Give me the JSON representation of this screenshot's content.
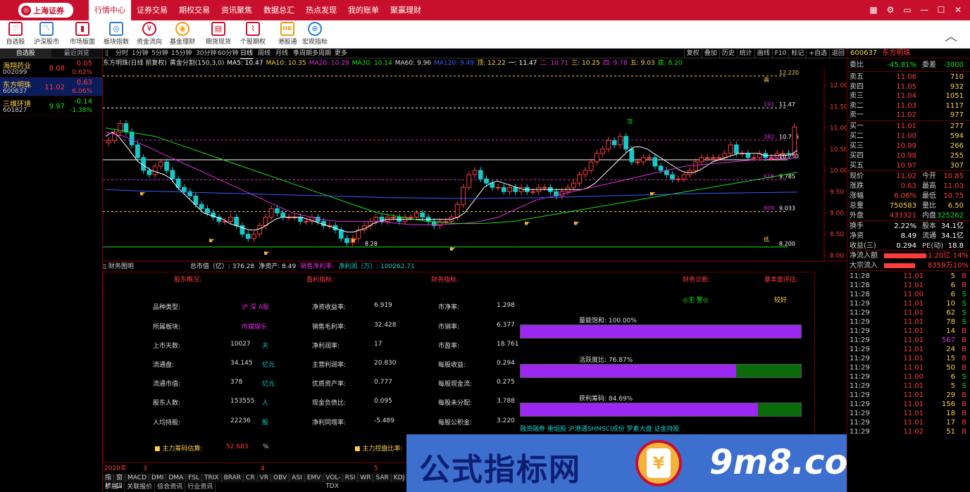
{
  "app": {
    "logo_text": "上海证券",
    "menu": [
      "行情中心",
      "证券交易",
      "期权交易",
      "资讯聚焦",
      "数据总汇",
      "热点发现",
      "我的账单",
      "聚赢理财"
    ],
    "window_controls": [
      "▦",
      "⚙",
      "▭",
      "—",
      "☐",
      "✕"
    ]
  },
  "toolbar": {
    "items": [
      "自选股",
      "沪深股市",
      "市场版面",
      "板块指数",
      "资金流向",
      "基金理财",
      "期货现货",
      "个股期权",
      "港股通",
      "宏观指标"
    ],
    "icons": [
      "heart",
      "line",
      "bar",
      "target",
      "yen",
      "coin",
      "doc",
      "chart",
      "hk",
      "globe"
    ]
  },
  "watchlist": {
    "tabs": [
      "自选股",
      "最近浏览"
    ],
    "items": [
      {
        "name": "海翔药业",
        "code": "002099",
        "price": "8.08",
        "change": "0.05",
        "pct": "0.62%",
        "dir": "up"
      },
      {
        "name": "东方明珠",
        "code": "600637",
        "price": "11.02",
        "change": "0.63",
        "pct": "6.06%",
        "dir": "up",
        "selected": true
      },
      {
        "name": "三维环境",
        "code": "601827",
        "price": "9.97",
        "change": "-0.14",
        "pct": "-1.38%",
        "dir": "dn"
      }
    ]
  },
  "kline": {
    "periods": [
      "分时",
      "1分钟",
      "5分钟",
      "15分钟",
      "30分钟",
      "60分钟",
      "日线",
      "周线",
      "月线",
      "季周期",
      "多周期",
      "更多"
    ],
    "selected_period": "日线",
    "right_tabs": [
      "复权",
      "叠加",
      "历史",
      "统计",
      "画线",
      "F10",
      "标记",
      "+自选",
      "返回"
    ],
    "legend": [
      {
        "t": "东方明珠(日线 前复权)",
        "c": "#dddddd"
      },
      {
        "t": "黄金分割(150,3,0)",
        "c": "#dddddd"
      },
      {
        "t": "MA5: 10.47",
        "c": "#ffffff"
      },
      {
        "t": "MA10: 10.35",
        "c": "#ffd24a"
      },
      {
        "t": "MA20: 10.29",
        "c": "#e12be0"
      },
      {
        "t": "MA30: 10.14",
        "c": "#17e217"
      },
      {
        "t": "MA60: 9.96",
        "c": "#dddddd"
      },
      {
        "t": "MA120: 9.49",
        "c": "#3a5cff"
      },
      {
        "t": "顶: 12.22",
        "c": "#ffd24a"
      },
      {
        "t": "一: 11.47",
        "c": "#ffffff"
      },
      {
        "t": "二: 10.71",
        "c": "#e12be0"
      },
      {
        "t": "三: 10.25",
        "c": "#ffd24a"
      },
      {
        "t": "四: 9.78",
        "c": "#e12be0"
      },
      {
        "t": "五: 9.03",
        "c": "#ffd24a"
      },
      {
        "t": "底: 8.20",
        "c": "#17e217"
      }
    ],
    "y_ticks": [
      "12.00",
      "11.50",
      "11.00",
      "10.50",
      "10.00",
      "9.50",
      "9.00",
      "8.50",
      "8.00"
    ],
    "level_labels": {
      "top": "12.220",
      "high_tag": "高",
      "l191": "191",
      "l382": "382",
      "l618": "618",
      "l809": "809",
      "l1147": "11.47",
      "l1071": "10.716",
      "l1025": "10.250",
      "l978": "9.785",
      "l903": "9.033",
      "l820": "8.200",
      "low_tag": "低",
      "low_price": "8.28",
      "ding": "顶"
    },
    "chart_data": {
      "type": "candlestick",
      "ylim": [
        7.85,
        12.4
      ],
      "close": [
        10.7,
        10.9,
        11.1,
        10.9,
        10.6,
        10.3,
        10.0,
        9.9,
        10.1,
        10.2,
        10.0,
        9.8,
        9.6,
        9.5,
        9.4,
        9.2,
        9.1,
        9.0,
        8.9,
        8.8,
        8.8,
        8.9,
        8.7,
        8.5,
        8.4,
        8.5,
        8.7,
        8.9,
        9.1,
        9.0,
        8.9,
        8.9,
        8.9,
        8.8,
        8.8,
        8.9,
        8.8,
        8.7,
        8.7,
        8.6,
        8.4,
        8.3,
        8.4,
        8.6,
        8.7,
        8.8,
        8.9,
        8.8,
        8.9,
        8.9,
        8.8,
        8.9,
        8.9,
        9.0,
        8.9,
        8.8,
        8.7,
        8.8,
        8.8,
        8.9,
        9.2,
        9.6,
        9.9,
        10.0,
        9.8,
        9.7,
        9.6,
        9.6,
        9.5,
        9.6,
        9.5,
        9.6,
        9.5,
        9.5,
        9.6,
        9.6,
        9.5,
        9.4,
        9.5,
        9.6,
        9.7,
        9.9,
        10.0,
        10.2,
        10.4,
        10.5,
        10.7,
        10.6,
        10.8,
        10.5,
        10.2,
        10.2,
        10.3,
        10.3,
        10.1,
        10.0,
        9.9,
        9.8,
        9.8,
        9.9,
        10.0,
        10.2,
        10.3,
        10.3,
        10.3,
        10.3,
        10.4,
        10.6,
        10.4,
        10.4,
        10.3,
        10.3,
        10.4,
        10.3,
        10.3,
        10.4,
        10.4,
        10.39,
        11.02
      ],
      "ma5": [
        10.8,
        10.9,
        10.8,
        10.6,
        10.4,
        10.2,
        10.1,
        10.0,
        9.95,
        9.9,
        9.8,
        9.6,
        9.45,
        9.3,
        9.15,
        9.0,
        8.95,
        8.9,
        8.85,
        8.75,
        8.7,
        8.65,
        8.6,
        8.6,
        8.65,
        8.75,
        8.85,
        8.9,
        8.9,
        8.9,
        8.9,
        8.85,
        8.8,
        8.75,
        8.7,
        8.65,
        8.6,
        8.55,
        8.55,
        8.6,
        8.65,
        8.75,
        8.8,
        8.85,
        8.85,
        8.85,
        8.85,
        8.85,
        8.85,
        8.85,
        8.85,
        8.85,
        8.85,
        8.85,
        8.9,
        9.0,
        9.2,
        9.4,
        9.6,
        9.7,
        9.75,
        9.7,
        9.65,
        9.6,
        9.55,
        9.55,
        9.55,
        9.55,
        9.55,
        9.55,
        9.55,
        9.55,
        9.55,
        9.55,
        9.6,
        9.7,
        9.85,
        10.0,
        10.15,
        10.3,
        10.45,
        10.55,
        10.55,
        10.5,
        10.4,
        10.3,
        10.2,
        10.1,
        10.0,
        9.95,
        9.95,
        10.0,
        10.1,
        10.2,
        10.25,
        10.3,
        10.35,
        10.4,
        10.4,
        10.4,
        10.4,
        10.35,
        10.35,
        10.35,
        10.35,
        10.37,
        10.47
      ],
      "ma20": [
        10.9,
        10.85,
        10.8,
        10.7,
        10.6,
        10.5,
        10.4,
        10.3,
        10.2,
        10.1,
        10.0,
        9.9,
        9.8,
        9.7,
        9.6,
        9.5,
        9.4,
        9.3,
        9.2,
        9.1,
        9.0,
        8.95,
        8.9,
        8.85,
        8.82,
        8.8,
        8.8,
        8.8,
        8.8,
        8.8,
        8.78,
        8.76,
        8.74,
        8.72,
        8.72,
        8.72,
        8.73,
        8.74,
        8.75,
        8.77,
        8.8,
        8.85,
        8.9,
        9.0,
        9.1,
        9.2,
        9.3,
        9.35,
        9.4,
        9.45,
        9.5,
        9.55,
        9.6,
        9.65,
        9.7,
        9.75,
        9.8,
        9.85,
        9.9,
        9.95,
        10.0,
        10.05,
        10.1,
        10.12,
        10.14,
        10.16,
        10.18,
        10.2,
        10.22,
        10.24,
        10.25,
        10.26,
        10.27,
        10.28,
        10.29
      ],
      "ma60": [
        11.0,
        10.95,
        10.9,
        10.85,
        10.8,
        10.7,
        10.6,
        10.5,
        10.4,
        10.3,
        10.2,
        10.1,
        10.0,
        9.9,
        9.8,
        9.7,
        9.6,
        9.5,
        9.4,
        9.3,
        9.2,
        9.1,
        9.0,
        8.95,
        8.9,
        8.85,
        8.8,
        8.78,
        8.76,
        8.75,
        8.75,
        8.76,
        8.78,
        8.8,
        8.85,
        8.9,
        8.95,
        9.0,
        9.05,
        9.1,
        9.15,
        9.2,
        9.25,
        9.3,
        9.35,
        9.4,
        9.45,
        9.5,
        9.55,
        9.6,
        9.65,
        9.7,
        9.75,
        9.8,
        9.85,
        9.9,
        9.96
      ],
      "ma120": [
        9.55,
        9.52,
        9.5,
        9.48,
        9.46,
        9.44,
        9.42,
        9.4,
        9.38,
        9.36,
        9.35,
        9.34,
        9.34,
        9.35,
        9.36,
        9.38,
        9.4,
        9.42,
        9.44,
        9.46,
        9.47,
        9.48,
        9.49
      ],
      "levels": [
        12.22,
        11.47,
        10.71,
        10.25,
        9.78,
        9.03,
        8.2
      ]
    }
  },
  "finance": {
    "title": "财务图明",
    "summary": [
      {
        "t": "总市值（亿）: 376.28",
        "c": "#dddddd"
      },
      {
        "t": "净资产: 8.49",
        "c": "#dddddd"
      },
      {
        "t": "销售净利率:",
        "c": "#e12be0"
      },
      {
        "t": "净利润（万）: 100262.71",
        "c": "#17c8c8"
      }
    ],
    "headers": [
      "股东概况:",
      "盈利指标:",
      "财务指标:",
      "财务诊断:",
      "基本面评估:"
    ],
    "col1": [
      [
        "品种类型:",
        "沪 深 A股",
        ""
      ],
      [
        "所属板块:",
        "传媒娱乐",
        ""
      ],
      [
        "上市天数:",
        "10027",
        "天"
      ],
      [
        "流通盘:",
        "34.145",
        "亿元"
      ],
      [
        "流通市值:",
        "378",
        "亿元"
      ],
      [
        "股东人数:",
        "153555",
        "人"
      ],
      [
        "人均持股:",
        "22236",
        "股"
      ]
    ],
    "col2": [
      [
        "净资收益率:",
        "6.919"
      ],
      [
        "销售毛利率:",
        "32.428"
      ],
      [
        "净利润率:",
        "17"
      ],
      [
        "主营利润率:",
        "20.830"
      ],
      [
        "优质资产率:",
        "0.777"
      ],
      [
        "现金负债比:",
        "0.095"
      ],
      [
        "净利同增率:",
        "-5.489"
      ]
    ],
    "col3": [
      [
        "市净率:",
        "1.298"
      ],
      [
        "市销率:",
        "6.377"
      ],
      [
        "市盈率:",
        "18.761"
      ],
      [
        "每股收益:",
        "0.294"
      ],
      [
        "每股现金流:",
        "0.275"
      ],
      [
        "每股未分配:",
        "3.788"
      ],
      [
        "每股公积金:",
        "3.220"
      ]
    ],
    "diag": "◎无 警◎",
    "assess": "较好",
    "bars": [
      {
        "label": "量能饱和:  100.00%",
        "fill": 1.0
      },
      {
        "label": "活跃度比:  76.87%",
        "fill": 0.7687
      },
      {
        "label": "获利筹码:  84.69%",
        "fill": 0.8469
      }
    ],
    "concepts": "融资融券 重组股 沪港通SHMSCI成份 罗素大盘 证金持股",
    "chip_label": "主力筹码估算:",
    "chip_value": "52.683",
    "chip_unit": "%",
    "ctrl_label": "主力控盘比率:"
  },
  "bottom": {
    "year_row": [
      "2020年",
      "3",
      "4",
      "5"
    ],
    "indicators": [
      "指标A",
      "窗口",
      "MACD",
      "DMI",
      "DMA",
      "FSL",
      "TRIX",
      "BRAR",
      "CR",
      "VR",
      "OBV",
      "ASI",
      "EMV",
      "VOL-TDX",
      "RSI",
      "WR",
      "SAR",
      "KDJ",
      "C"
    ],
    "tabs": [
      "扩展A",
      "关联报价",
      "综合资讯",
      "行业资讯"
    ]
  },
  "watermark": {
    "cn": "公式指标网",
    "en": "9m8.com",
    "seal_char": "¥"
  },
  "quote": {
    "code": "600637",
    "name": "东方明珠",
    "weibi_label": "委比",
    "weibi": "-45.81%",
    "weicha_label": "委差",
    "weicha": "-3000",
    "asks": [
      [
        "卖五",
        "11.06",
        "710"
      ],
      [
        "卖四",
        "11.05",
        "932"
      ],
      [
        "卖三",
        "11.04",
        "1051"
      ],
      [
        "卖二",
        "11.03",
        "1117"
      ],
      [
        "卖一",
        "11.02",
        "977"
      ]
    ],
    "bids": [
      [
        "买一",
        "11.01",
        "277"
      ],
      [
        "买二",
        "11.00",
        "594"
      ],
      [
        "买三",
        "10.99",
        "266"
      ],
      [
        "买四",
        "10.98",
        "255"
      ],
      [
        "买五",
        "10.97",
        "307"
      ]
    ],
    "stats": [
      [
        "现价",
        "11.02",
        "up",
        "今开",
        "10.85",
        "up"
      ],
      [
        "涨跌",
        "0.63",
        "up",
        "最高",
        "11.03",
        "up"
      ],
      [
        "涨幅",
        "6.06%",
        "up",
        "最低",
        "10.75",
        "up"
      ],
      [
        "总量",
        "750583",
        "yel",
        "量比",
        "6.50",
        "yel"
      ],
      [
        "外盘",
        "433321",
        "up",
        "内盘",
        "325262",
        "dn"
      ]
    ],
    "stats2": [
      [
        "换手",
        "2.22%",
        "股本",
        "34.1亿"
      ],
      [
        "净资",
        "8.49",
        "流通",
        "34.1亿"
      ],
      [
        "收益(三)",
        "0.294",
        "PE(动)",
        "18.8"
      ]
    ],
    "flow": [
      [
        "净流入额",
        "1.20亿",
        "14%"
      ],
      [
        "大宗流入",
        "8359万",
        "10%"
      ]
    ],
    "ticks": [
      [
        "11:28",
        "11.01",
        "5",
        "B"
      ],
      [
        "11:28",
        "11.01",
        "6",
        "B"
      ],
      [
        "11:28",
        "11.00",
        "6",
        "S"
      ],
      [
        "11:29",
        "11.01",
        "10",
        "S"
      ],
      [
        "11:29",
        "11.01",
        "62",
        "S"
      ],
      [
        "11:29",
        "11.01",
        "78",
        "S"
      ],
      [
        "11:29",
        "11.01",
        "14",
        "B"
      ],
      [
        "11:29",
        "11.01",
        "567",
        "B"
      ],
      [
        "11:29",
        "11.01",
        "24",
        "B"
      ],
      [
        "11:29",
        "11.01",
        "15",
        "B"
      ],
      [
        "11:29",
        "11.01",
        "50",
        "B"
      ],
      [
        "11:29",
        "11.00",
        "6",
        "S"
      ],
      [
        "11:29",
        "11.01",
        "5",
        "S"
      ],
      [
        "11:29",
        "11.01",
        "29",
        "B"
      ],
      [
        "11:29",
        "11.01",
        "156",
        "B"
      ],
      [
        "11:29",
        "11.01",
        "18",
        "B"
      ],
      [
        "11:29",
        "11.01",
        "17",
        "B"
      ],
      [
        "11:29",
        "11.02",
        "51",
        "B"
      ]
    ]
  }
}
